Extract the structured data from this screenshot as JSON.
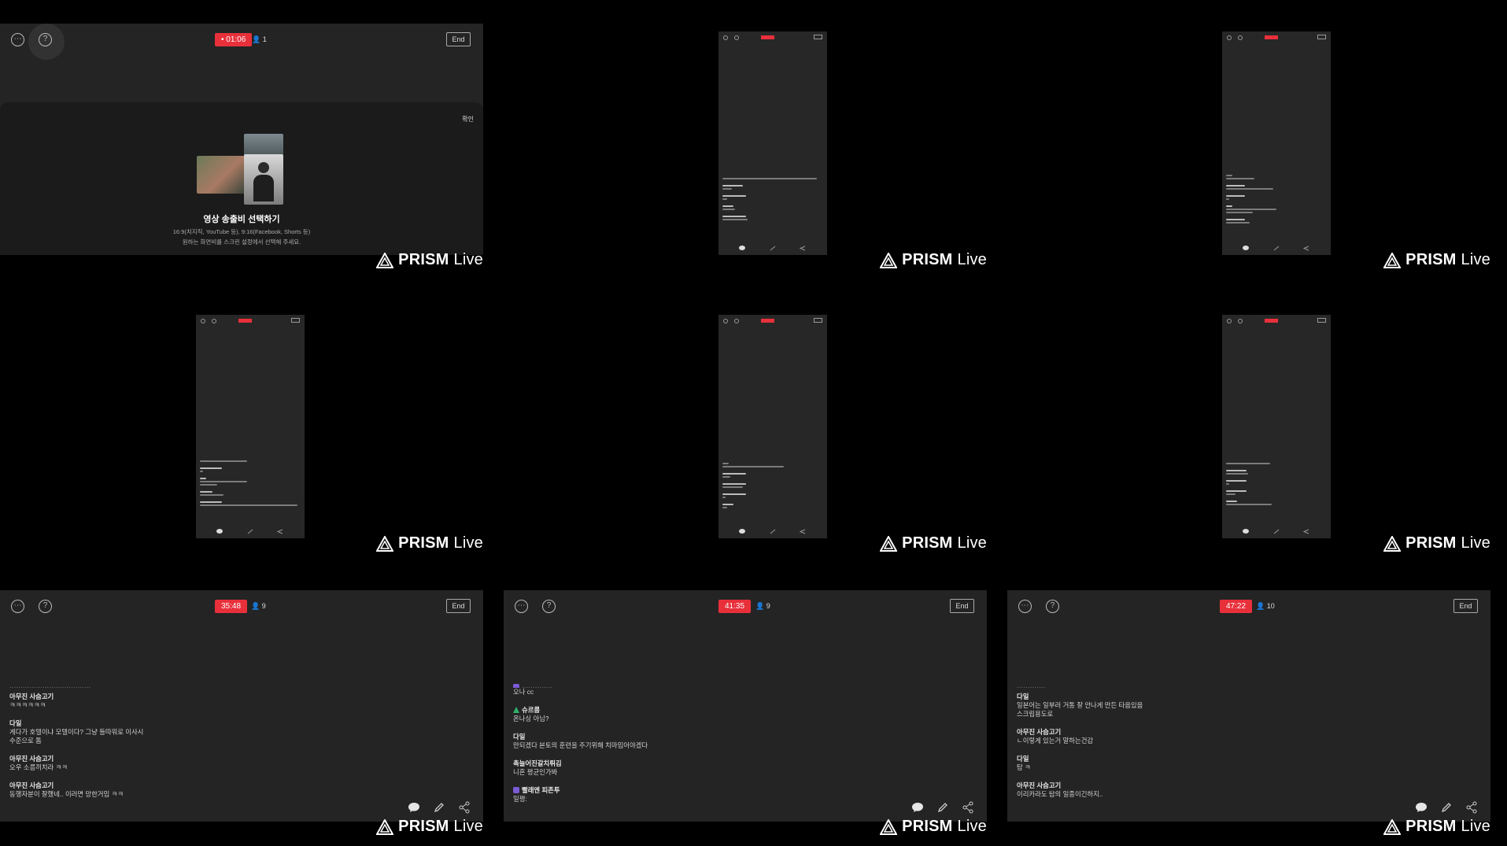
{
  "watermark": {
    "brand": "PRISM",
    "product": "Live"
  },
  "panel1": {
    "timer": "• 01:06",
    "viewers": "1",
    "end_label": "End",
    "sheet": {
      "confirm_label": "확인",
      "title": "영상 송출비 선택하기",
      "subtitle_line1": "16:9(치지직, YouTube 등), 9:16(Facebook, Shorts 등)",
      "subtitle_line2": "원하는 화면비를 스크린 설정에서 선택해 주세요."
    }
  },
  "panel7": {
    "timer": "35:48",
    "viewers": "9",
    "end_label": "End",
    "messages": [
      {
        "author": "아무진 사슴고기",
        "text": "ㅋㅋㅋㅋㅋㅋ"
      },
      {
        "author": "다일",
        "text": "게다가 호텔이냐 모텔이다? 그냥 들따워로 이사시",
        "text2": "수준으로 톰"
      },
      {
        "author": "아무진 사슴고기",
        "text": "오우 소름끼치라 ㅋㅋ"
      },
      {
        "author": "아무진 사슴고기",
        "text": "동행자분이 잘했네.. 이러면 망한거임 ㅋㅋ"
      }
    ]
  },
  "panel8": {
    "timer": "41:35",
    "viewers": "9",
    "end_label": "End",
    "messages": [
      {
        "author": "",
        "text": "오나 cc",
        "badge": "purple"
      },
      {
        "author": "슈르름",
        "text": "온나싱 아님?",
        "badge": "green"
      },
      {
        "author": "다일",
        "text": "만되겠다 본토의 훈련을 주기위해 치마입어야겠다"
      },
      {
        "author": "촉늘어진갈치튀김",
        "text": "니혼 평균인가봐"
      },
      {
        "author": "빨래엔 피존투",
        "text": "일평:",
        "badge": "purple"
      }
    ]
  },
  "panel9": {
    "timer": "47:22",
    "viewers": "10",
    "end_label": "End",
    "messages": [
      {
        "author": "다일",
        "text": "일본어는 일부러 거통 잘 안나게 만든 타음있음",
        "text2": "스크립용도로"
      },
      {
        "author": "아무진 사슴고기",
        "text": "ㄴ이렇게 있는거 말하는건감"
      },
      {
        "author": "다일",
        "text": "탑 ㅋ"
      },
      {
        "author": "아무진 사슴고기",
        "text": "이리카라도 탐의 일종이긴하지.."
      }
    ]
  },
  "icons": {
    "more": "more-icon",
    "help": "help-icon",
    "viewer": "person-icon",
    "chat": "chat-bubble-icon",
    "edit": "pencil-icon",
    "share": "share-icon"
  },
  "colors": {
    "live_red": "#e8303b",
    "panel_bg": "#242424",
    "background": "#000000"
  }
}
